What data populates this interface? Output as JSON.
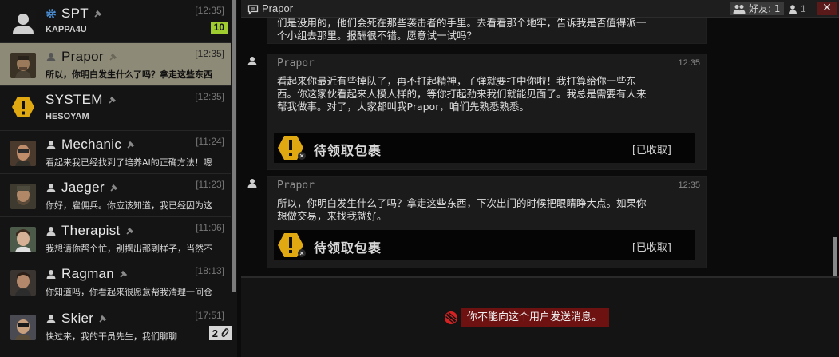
{
  "sidebar": {
    "items": [
      {
        "name": "SPT",
        "time": "[12:35]",
        "sub": "KAPPA4U",
        "badge": "10",
        "avatar": "default-avatar"
      },
      {
        "name": "Prapor",
        "time": "[12:35]",
        "preview": "所以，你明白发生什么了吗？拿走这些东西",
        "avatar": "prapor-avatar"
      },
      {
        "name": "SYSTEM",
        "time": "[12:35]",
        "sub": "HESOYAM",
        "avatar": "system-warning-avatar"
      },
      {
        "name": "Mechanic",
        "time": "[11:24]",
        "preview": "看起来我已经找到了培养AI的正确方法！嗯",
        "avatar": "mechanic-avatar"
      },
      {
        "name": "Jaeger",
        "time": "[11:23]",
        "preview": "你好，雇佣兵。你应该知道，我已经因为这",
        "avatar": "jaeger-avatar"
      },
      {
        "name": "Therapist",
        "time": "[11:06]",
        "preview": "我想请你帮个忙，别摆出那副样子，当然不",
        "avatar": "therapist-avatar"
      },
      {
        "name": "Ragman",
        "time": "[18:13]",
        "preview": "你知道吗，你看起来很愿意帮我清理一间仓",
        "avatar": "ragman-avatar"
      },
      {
        "name": "Skier",
        "time": "[17:51]",
        "preview": "快过来，我的干员先生，我们聊聊",
        "avatar": "skier-avatar"
      }
    ],
    "attachments_badge": "2"
  },
  "header": {
    "title": "Prapor",
    "friends_label": "好友: 1",
    "members_count": "1",
    "close_label": "✕"
  },
  "messages": [
    {
      "text": "们是没用的，他们会死在那些袭击者的手里。去看看那个地牢，告诉我是否值得派一个小组去那里。报酬很不错。愿意试一试吗？"
    },
    {
      "author": "Prapor",
      "time": "12:35",
      "text": "看起来你最近有些掉队了，再不打起精神，子弹就要打中你啦！我打算给你一些东西。你这家伙看起来人模人样的，等你打起劲来我们就能见面了。我总是需要有人来帮我做事。对了，大家都叫我Prapor，咱们先熟悉熟悉。",
      "package_label": "待领取包裹",
      "package_status": "[已收取]"
    },
    {
      "author": "Prapor",
      "time": "12:35",
      "text": "所以，你明白发生什么了吗？拿走这些东西，下次出门的时候把眼睛睁大点。如果你想做交易，来找我就好。",
      "package_label": "待领取包裹",
      "package_status": "[已收取]"
    }
  ],
  "footer": {
    "cannot_send": "你不能向这个用户发送消息。"
  },
  "colors": {
    "selected_item": "#8e8a78",
    "badge_green": "#9fcc2e",
    "warning_red": "#6e1111",
    "system_yellow": "#e0a911"
  }
}
